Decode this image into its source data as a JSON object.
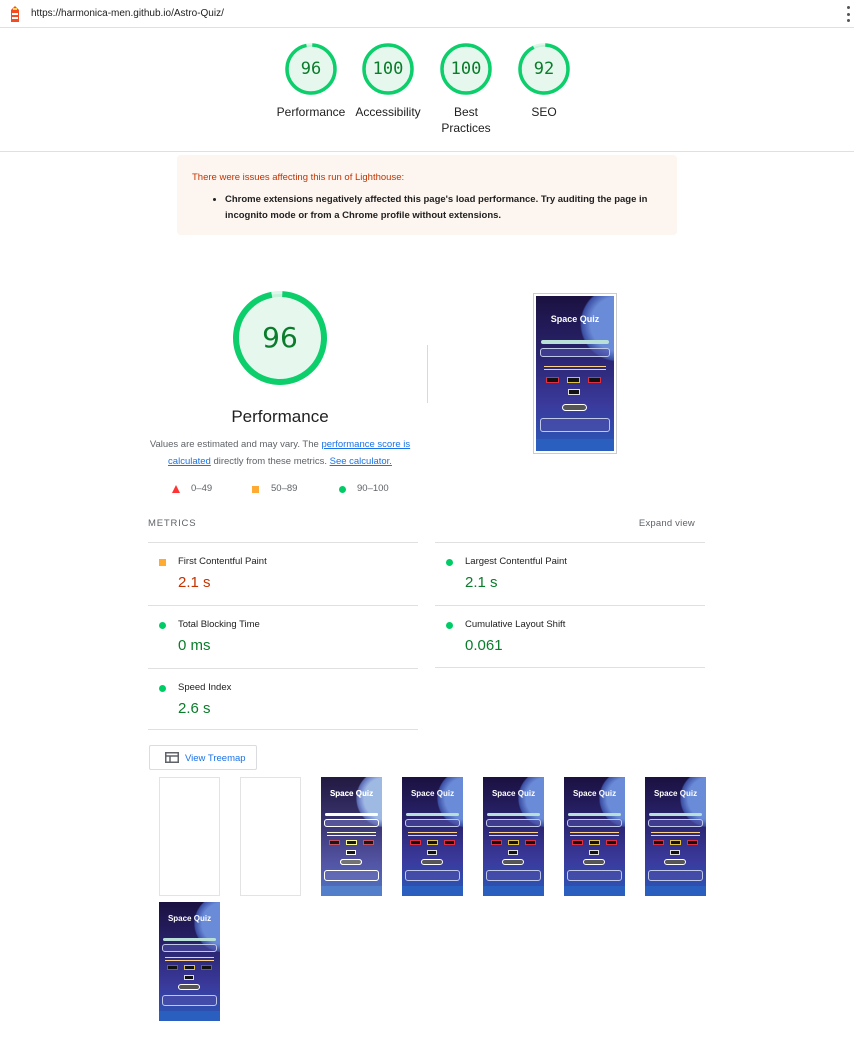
{
  "url_bar": {
    "url": "https://harmonica-men.github.io/Astro-Quiz/"
  },
  "summary": [
    {
      "label": "Performance",
      "score": "96"
    },
    {
      "label": "Accessibility",
      "score": "100"
    },
    {
      "label": "Best Practices",
      "score": "100"
    },
    {
      "label": "SEO",
      "score": "92"
    }
  ],
  "warning": {
    "title": "There were issues affecting this run of Lighthouse:",
    "item": "Chrome extensions negatively affected this page's load performance. Try auditing the page in incognito mode or from a Chrome profile without extensions."
  },
  "performance": {
    "score": "96",
    "title": "Performance",
    "desc_pre": "Values are estimated and may vary. The ",
    "desc_link1": "performance score is calculated",
    "desc_mid": " directly from these metrics. ",
    "desc_link2": "See calculator."
  },
  "legend": {
    "fail": "0–49",
    "average": "50–89",
    "pass": "90–100"
  },
  "screenshot": {
    "title": "Space Quiz"
  },
  "metrics": {
    "heading": "METRICS",
    "expand": "Expand view",
    "items": [
      {
        "name": "First Contentful Paint",
        "value": "2.1 s",
        "rating": "average"
      },
      {
        "name": "Largest Contentful Paint",
        "value": "2.1 s",
        "rating": "pass"
      },
      {
        "name": "Total Blocking Time",
        "value": "0 ms",
        "rating": "pass"
      },
      {
        "name": "Cumulative Layout Shift",
        "value": "0.061",
        "rating": "pass"
      },
      {
        "name": "Speed Index",
        "value": "2.6 s",
        "rating": "pass"
      }
    ]
  },
  "treemap": {
    "label": "View Treemap"
  },
  "filmstrip": {
    "frame_title": "Space Quiz"
  },
  "colors": {
    "pass": "#0cce6b",
    "average": "#ffa400",
    "fail": "#ff4e42",
    "link": "#1a73e8"
  }
}
